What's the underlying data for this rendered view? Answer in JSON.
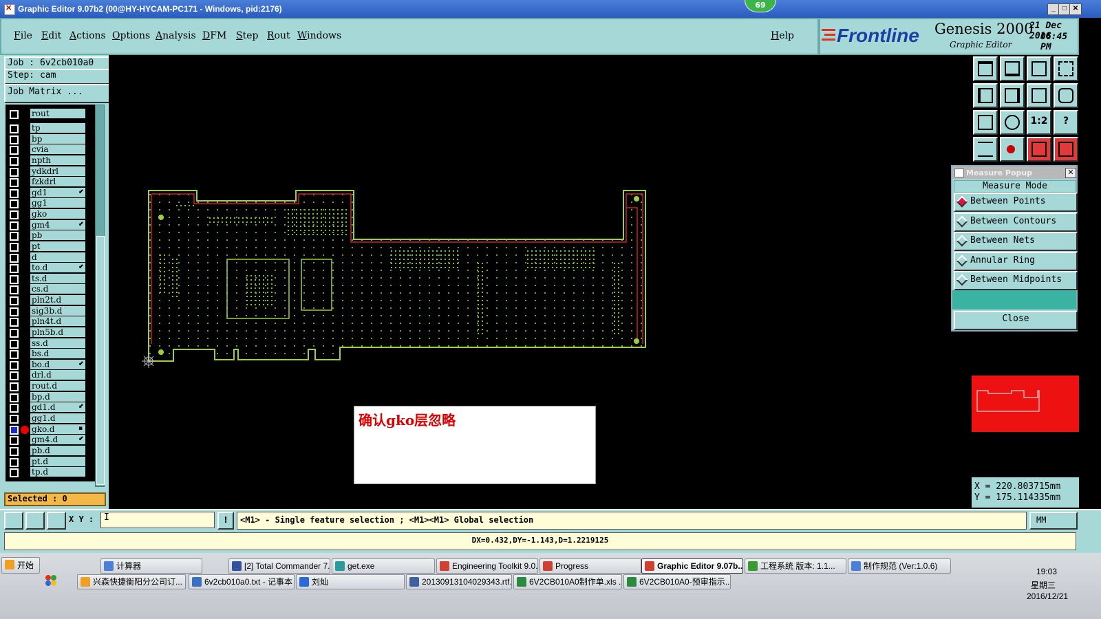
{
  "window": {
    "title": "Graphic Editor 9.07b2 (00@HY-HYCAM-PC171 - Windows, pid:2176)",
    "badge": "69",
    "min": "_",
    "max": "□",
    "close": "✕"
  },
  "menu": {
    "items": [
      "File",
      "Edit",
      "Actions",
      "Options",
      "Analysis",
      "DFM",
      "Step",
      "Rout",
      "Windows"
    ],
    "help": "Help"
  },
  "logo": {
    "brand": "Frontline",
    "product": "Genesis 2000",
    "subtitle": "Graphic Editor",
    "date": "21 Dec 2016",
    "time": "06:45 PM"
  },
  "left": {
    "job": "Job  :  6v2cb010a0",
    "step": "Step:  cam",
    "job_matrix": "Job Matrix ...",
    "selected": "Selected : 0",
    "layers": [
      {
        "name": "rout",
        "mark": ""
      },
      {
        "name": "tp",
        "mark": ""
      },
      {
        "name": "bp",
        "mark": ""
      },
      {
        "name": "cvia",
        "mark": ""
      },
      {
        "name": "npth",
        "mark": ""
      },
      {
        "name": "ydkdrl",
        "mark": ""
      },
      {
        "name": "fzkdrl",
        "mark": ""
      },
      {
        "name": "gd1",
        "mark": "⬋"
      },
      {
        "name": "gg1",
        "mark": ""
      },
      {
        "name": "gko",
        "mark": ""
      },
      {
        "name": "gm4",
        "mark": "⬋"
      },
      {
        "name": "pb",
        "mark": ""
      },
      {
        "name": "pt",
        "mark": ""
      },
      {
        "name": "d",
        "mark": ""
      },
      {
        "name": "to.d",
        "mark": "⬋"
      },
      {
        "name": "ts.d",
        "mark": ""
      },
      {
        "name": "cs.d",
        "mark": ""
      },
      {
        "name": "pln2t.d",
        "mark": ""
      },
      {
        "name": "sig3b.d",
        "mark": ""
      },
      {
        "name": "pln4t.d",
        "mark": ""
      },
      {
        "name": "pln5b.d",
        "mark": ""
      },
      {
        "name": "ss.d",
        "mark": ""
      },
      {
        "name": "bs.d",
        "mark": ""
      },
      {
        "name": "bo.d",
        "mark": "⬋"
      },
      {
        "name": "drl.d",
        "mark": ""
      },
      {
        "name": "rout.d",
        "mark": ""
      },
      {
        "name": "bp.d",
        "mark": ""
      },
      {
        "name": "gd1.d",
        "mark": "⬋"
      },
      {
        "name": "gg1.d",
        "mark": ""
      },
      {
        "name": "gko.d",
        "mark": "▪"
      },
      {
        "name": "gm4.d",
        "mark": "⬋"
      },
      {
        "name": "pb.d",
        "mark": ""
      },
      {
        "name": "pt.d",
        "mark": ""
      },
      {
        "name": "tp.d",
        "mark": ""
      }
    ]
  },
  "note": {
    "text": "确认gko层忽略"
  },
  "measure": {
    "title": "Measure Popup",
    "mode_label": "Measure Mode",
    "options": [
      "Between Points",
      "Between Contours",
      "Between Nets",
      "Annular Ring",
      "Between Midpoints"
    ],
    "active_option": 0,
    "close": "Close"
  },
  "toolbar": {
    "ratio_label": "1:2",
    "help_label": "?"
  },
  "coords": {
    "x": "X = 220.803715mm",
    "y": "Y = 175.114335mm"
  },
  "command": {
    "xy_label": "X Y :",
    "xy_value": "I",
    "bang": "!",
    "hint": "<M1> - Single feature selection ; <M1><M1> Global selection",
    "unit": "MM"
  },
  "status": {
    "text": "DX=0.432,DY=-1.143,D=1.2219125"
  },
  "taskbar": {
    "start": "开始",
    "row1": [
      "计算器",
      "[2] Total Commander 7....",
      "get.exe",
      "Engineering Toolkit 9.0....",
      "Progress",
      "Graphic Editor 9.07b...",
      "工程系统  版本: 1.1...",
      "制作规范 (Ver:1.0.6)"
    ],
    "row2": [
      "兴森快捷衡阳分公司订...",
      "6v2cb010a0.txt - 记事本",
      "刘灿",
      "20130913104029343.rtf...",
      "6V2CB010A0制作单.xls ...",
      "6V2CB010A0-预审指示...."
    ],
    "clock": {
      "time": "19:03",
      "day": "星期三",
      "date": "2016/12/21"
    }
  },
  "colors": {
    "panel": "#a6d8d8",
    "board_outline": "#9fd037",
    "route": "#e02020",
    "selected_bg": "#f4b84a"
  }
}
